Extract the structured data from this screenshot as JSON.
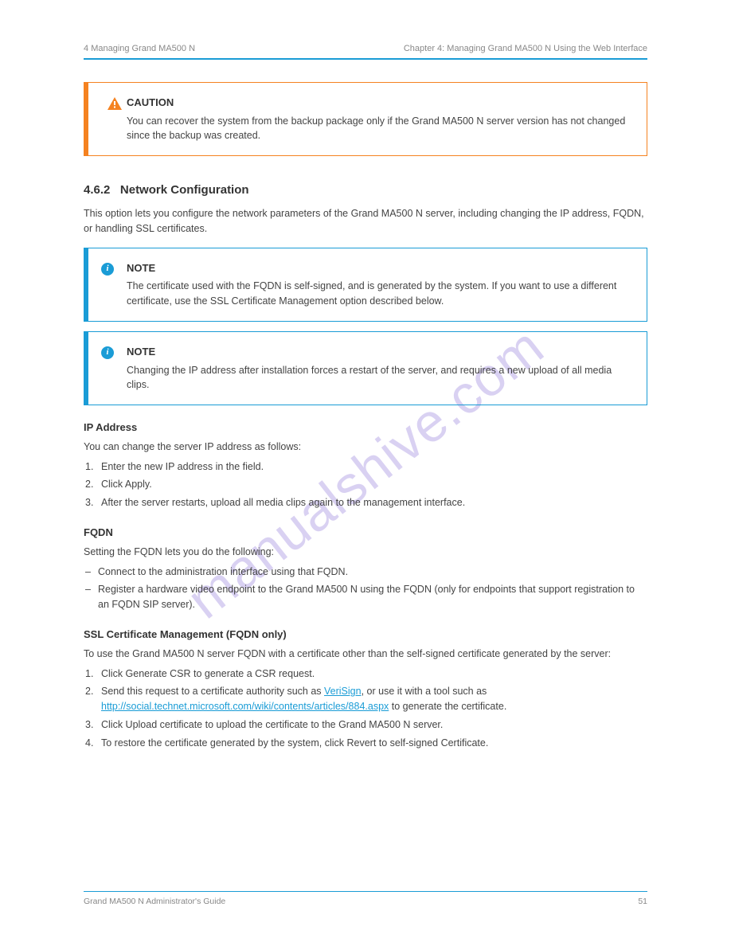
{
  "header": {
    "section_number": "4",
    "section_title": "Managing Grand MA500 N",
    "chapter_line": "Chapter 4: Managing Grand MA500 N Using the Web Interface"
  },
  "warning_box": {
    "title": "CAUTION",
    "text": "You can recover the system from the backup package only if the Grand MA500 N server version has not changed since the backup was created."
  },
  "section": {
    "number": "4.6.2",
    "title": "Network Configuration",
    "intro": "This option lets you configure the network parameters of the Grand MA500 N server, including changing the IP address, FQDN, or handling SSL certificates.",
    "note1": {
      "title": "NOTE",
      "text": "The certificate used with the FQDN is self-signed, and is generated by the system. If you want to use a different certificate, use the SSL Certificate Management option described below."
    },
    "note2": {
      "title": "NOTE",
      "text": "Changing the IP address after installation forces a restart of the server, and requires a new upload of all media clips."
    },
    "ip_heading": "IP Address",
    "ip_intro": "You can change the server IP address as follows:",
    "ip_steps": [
      "Enter the new IP address in the field.",
      "Click Apply.",
      "After the server restarts, upload all media clips again to the management interface."
    ],
    "fqdn_heading": "FQDN",
    "fqdn_intro": "Setting the FQDN lets you do the following:",
    "fqdn_bullets": [
      "Connect to the administration interface using that FQDN.",
      "Register a hardware video endpoint to the Grand MA500 N using the FQDN (only for endpoints that support registration to an FQDN SIP server)."
    ],
    "ssl_heading": "SSL Certificate Management (FQDN only)",
    "ssl_intro": "To use the Grand MA500 N server FQDN with a certificate other than the self-signed certificate generated by the server:",
    "ssl_steps_pre": "Click Generate CSR to generate a CSR request.",
    "ssl_step2_pre": "Send this request to a certificate authority such as ",
    "ssl_verisign": "VeriSign",
    "ssl_step2_post": ", or use it with a tool such as ",
    "ssl_link": "http://social.technet.microsoft.com/wiki/contents/articles/884.aspx",
    "ssl_step2_tail": " to generate the certificate.",
    "ssl_step3": "Click Upload certificate to upload the certificate to the Grand MA500 N server.",
    "ssl_step4": "To restore the certificate generated by the system, click Revert to self-signed Certificate."
  },
  "footer": {
    "left": "Grand MA500 N Administrator's Guide",
    "right": "51"
  },
  "watermark": "manualshive.com"
}
